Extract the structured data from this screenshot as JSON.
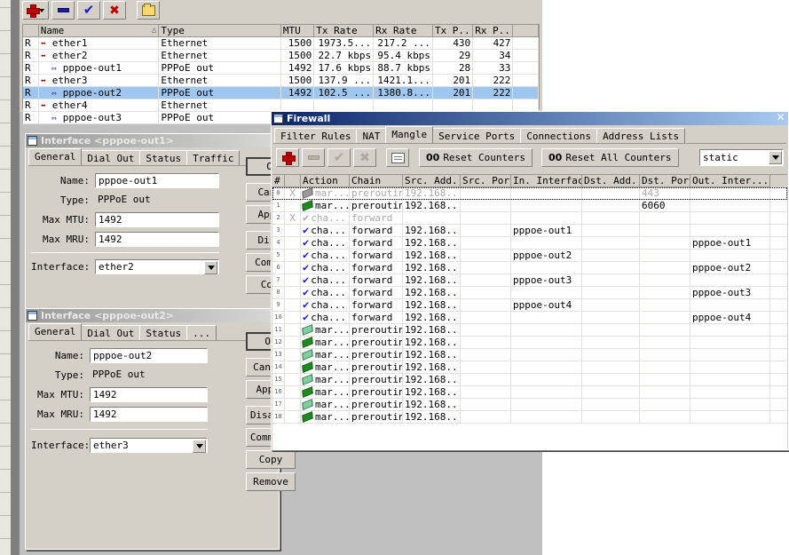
{
  "interface_window": {
    "toolbar": [
      {
        "name": "add-button",
        "icon": "plus-icon",
        "label": "+"
      },
      {
        "name": "remove-button",
        "icon": "minus-icon",
        "label": "-"
      },
      {
        "name": "enable-button",
        "icon": "check-icon",
        "label": "v"
      },
      {
        "name": "disable-button",
        "icon": "x-icon",
        "label": "x"
      },
      {
        "name": "comment-button",
        "icon": "folder-icon",
        "label": "folder"
      }
    ],
    "columns": [
      "",
      "Name",
      "Type",
      "MTU",
      "Tx Rate",
      "Rx Rate",
      "Tx P...",
      "Rx P...",
      ""
    ],
    "sort_column": "Name",
    "rows": [
      {
        "flag": "R",
        "name": "ether1",
        "type": "Ethernet",
        "mtu": "1500",
        "tx": "1973.5...",
        "rx": "217.2 ...",
        "txp": "430",
        "rxp": "427",
        "indent": 0,
        "icon": "ethernet-icon",
        "selected": false
      },
      {
        "flag": "R",
        "name": "ether2",
        "type": "Ethernet",
        "mtu": "1500",
        "tx": "22.7 kbps",
        "rx": "95.4 kbps",
        "txp": "29",
        "rxp": "34",
        "indent": 0,
        "icon": "ethernet-icon",
        "selected": false
      },
      {
        "flag": "R",
        "name": "pppoe-out1",
        "type": "PPPoE out",
        "mtu": "1492",
        "tx": "17.6 kbps",
        "rx": "88.7 kbps",
        "txp": "28",
        "rxp": "33",
        "indent": 1,
        "icon": "pppoe-icon",
        "selected": false
      },
      {
        "flag": "R",
        "name": "ether3",
        "type": "Ethernet",
        "mtu": "1500",
        "tx": "137.9 ...",
        "rx": "1421.1...",
        "txp": "201",
        "rxp": "222",
        "indent": 0,
        "icon": "ethernet-icon",
        "selected": false
      },
      {
        "flag": "R",
        "name": "pppoe-out2",
        "type": "PPPoE out",
        "mtu": "1492",
        "tx": "102.5 ...",
        "rx": "1380.8...",
        "txp": "201",
        "rxp": "222",
        "indent": 1,
        "icon": "pppoe-icon",
        "selected": true
      },
      {
        "flag": "R",
        "name": "ether4",
        "type": "Ethernet",
        "mtu": "",
        "tx": "",
        "rx": "",
        "txp": "",
        "rxp": "",
        "indent": 0,
        "icon": "ethernet-icon",
        "selected": false
      },
      {
        "flag": "R",
        "name": "pppoe-out3",
        "type": "PPPoE out",
        "mtu": "",
        "tx": "",
        "rx": "",
        "txp": "",
        "rxp": "",
        "indent": 1,
        "icon": "pppoe-icon",
        "selected": false
      }
    ]
  },
  "dialog1": {
    "title": "Interface <pppoe-out1>",
    "tabs": [
      "General",
      "Dial Out",
      "Status",
      "Traffic"
    ],
    "active_tab": "General",
    "fields": {
      "name_label": "Name:",
      "name_value": "pppoe-out1",
      "type_label": "Type:",
      "type_value": "PPPoE out",
      "mtu_label": "Max MTU:",
      "mtu_value": "1492",
      "mru_label": "Max MRU:",
      "mru_value": "1492",
      "interface_label": "Interface:",
      "interface_value": "ether2"
    },
    "buttons": [
      "OK",
      "Cance",
      "Apply",
      "Disab",
      "Commer",
      "Copy"
    ]
  },
  "dialog2": {
    "title": "Interface <pppoe-out2>",
    "tabs": [
      "General",
      "Dial Out",
      "Status",
      "..."
    ],
    "active_tab": "General",
    "fields": {
      "name_label": "Name:",
      "name_value": "pppoe-out2",
      "type_label": "Type:",
      "type_value": "PPPoE out",
      "mtu_label": "Max MTU:",
      "mtu_value": "1492",
      "mru_label": "Max MRU:",
      "mru_value": "1492",
      "interface_label": "Interface:",
      "interface_value": "ether3"
    },
    "buttons": [
      "OK",
      "Cancel",
      "Apply",
      "Disable",
      "Comment",
      "Copy",
      "Remove"
    ]
  },
  "firewall": {
    "title": "Firewall",
    "close_label": "✕",
    "tabs": [
      "Filter Rules",
      "NAT",
      "Mangle",
      "Service Ports",
      "Connections",
      "Address Lists"
    ],
    "active_tab": "Mangle",
    "toolbar": {
      "add_label": "+",
      "remove_label": "-",
      "enable_label": "✓",
      "disable_label": "✖",
      "comment_label": "note",
      "reset_counters": "Reset Counters",
      "reset_counters_prefix": "00",
      "reset_all_counters": "Reset All Counters",
      "reset_all_counters_prefix": "00",
      "filter_value": "static"
    },
    "columns": [
      "#",
      "",
      "Action",
      "Chain",
      "Src. Add...",
      "Src. Port",
      "In. Interface",
      "Dst. Add...",
      "Dst. Port",
      "Out. Inter..."
    ],
    "rows": [
      {
        "num": "0",
        "x": "X",
        "action": "mar...",
        "action_icon": "marker-gray-icon",
        "chain": "prerouting",
        "src": "192.168...",
        "srcport": "",
        "inif": "",
        "dst": "",
        "dstport": "443",
        "outif": "",
        "disabled": true,
        "focused": true
      },
      {
        "num": "1",
        "x": "",
        "action": "mar...",
        "action_icon": "marker-green-icon",
        "chain": "prerouting",
        "src": "192.168...",
        "srcport": "",
        "inif": "",
        "dst": "",
        "dstport": "6060",
        "outif": "",
        "disabled": false,
        "focused": false
      },
      {
        "num": "2",
        "x": "X",
        "action": "cha...",
        "action_icon": "check-gray-icon",
        "chain": "forward",
        "src": "",
        "srcport": "",
        "inif": "",
        "dst": "",
        "dstport": "",
        "outif": "",
        "disabled": true,
        "focused": false
      },
      {
        "num": "3",
        "x": "",
        "action": "cha...",
        "action_icon": "check-blue-icon",
        "chain": "forward",
        "src": "192.168...",
        "srcport": "",
        "inif": "pppoe-out1",
        "dst": "",
        "dstport": "",
        "outif": "",
        "disabled": false,
        "focused": false
      },
      {
        "num": "4",
        "x": "",
        "action": "cha...",
        "action_icon": "check-blue-icon",
        "chain": "forward",
        "src": "192.168...",
        "srcport": "",
        "inif": "",
        "dst": "",
        "dstport": "",
        "outif": "pppoe-out1",
        "disabled": false,
        "focused": false
      },
      {
        "num": "5",
        "x": "",
        "action": "cha...",
        "action_icon": "check-blue-icon",
        "chain": "forward",
        "src": "192.168...",
        "srcport": "",
        "inif": "pppoe-out2",
        "dst": "",
        "dstport": "",
        "outif": "",
        "disabled": false,
        "focused": false
      },
      {
        "num": "6",
        "x": "",
        "action": "cha...",
        "action_icon": "check-blue-icon",
        "chain": "forward",
        "src": "192.168...",
        "srcport": "",
        "inif": "",
        "dst": "",
        "dstport": "",
        "outif": "pppoe-out2",
        "disabled": false,
        "focused": false
      },
      {
        "num": "7",
        "x": "",
        "action": "cha...",
        "action_icon": "check-blue-icon",
        "chain": "forward",
        "src": "192.168...",
        "srcport": "",
        "inif": "pppoe-out3",
        "dst": "",
        "dstport": "",
        "outif": "",
        "disabled": false,
        "focused": false
      },
      {
        "num": "8",
        "x": "",
        "action": "cha...",
        "action_icon": "check-blue-icon",
        "chain": "forward",
        "src": "192.168...",
        "srcport": "",
        "inif": "",
        "dst": "",
        "dstport": "",
        "outif": "pppoe-out3",
        "disabled": false,
        "focused": false
      },
      {
        "num": "9",
        "x": "",
        "action": "cha...",
        "action_icon": "check-blue-icon",
        "chain": "forward",
        "src": "192.168...",
        "srcport": "",
        "inif": "pppoe-out4",
        "dst": "",
        "dstport": "",
        "outif": "",
        "disabled": false,
        "focused": false
      },
      {
        "num": "10",
        "x": "",
        "action": "cha...",
        "action_icon": "check-blue-icon",
        "chain": "forward",
        "src": "192.168...",
        "srcport": "",
        "inif": "",
        "dst": "",
        "dstport": "",
        "outif": "pppoe-out4",
        "disabled": false,
        "focused": false
      },
      {
        "num": "11",
        "x": "",
        "action": "mar...",
        "action_icon": "marker-lgreen-icon",
        "chain": "prerouting",
        "src": "192.168...",
        "srcport": "",
        "inif": "",
        "dst": "",
        "dstport": "",
        "outif": "",
        "disabled": false,
        "focused": false
      },
      {
        "num": "12",
        "x": "",
        "action": "mar...",
        "action_icon": "marker-green-icon",
        "chain": "prerouting",
        "src": "192.168...",
        "srcport": "",
        "inif": "",
        "dst": "",
        "dstport": "",
        "outif": "",
        "disabled": false,
        "focused": false
      },
      {
        "num": "13",
        "x": "",
        "action": "mar...",
        "action_icon": "marker-lgreen-icon",
        "chain": "prerouting",
        "src": "192.168...",
        "srcport": "",
        "inif": "",
        "dst": "",
        "dstport": "",
        "outif": "",
        "disabled": false,
        "focused": false
      },
      {
        "num": "14",
        "x": "",
        "action": "mar...",
        "action_icon": "marker-green-icon",
        "chain": "prerouting",
        "src": "192.168...",
        "srcport": "",
        "inif": "",
        "dst": "",
        "dstport": "",
        "outif": "",
        "disabled": false,
        "focused": false
      },
      {
        "num": "15",
        "x": "",
        "action": "mar...",
        "action_icon": "marker-lgreen-icon",
        "chain": "prerouting",
        "src": "192.168...",
        "srcport": "",
        "inif": "",
        "dst": "",
        "dstport": "",
        "outif": "",
        "disabled": false,
        "focused": false
      },
      {
        "num": "16",
        "x": "",
        "action": "mar...",
        "action_icon": "marker-green-icon",
        "chain": "prerouting",
        "src": "192.168...",
        "srcport": "",
        "inif": "",
        "dst": "",
        "dstport": "",
        "outif": "",
        "disabled": false,
        "focused": false
      },
      {
        "num": "17",
        "x": "",
        "action": "mar...",
        "action_icon": "marker-lgreen-icon",
        "chain": "prerouting",
        "src": "192.168...",
        "srcport": "",
        "inif": "",
        "dst": "",
        "dstport": "",
        "outif": "",
        "disabled": false,
        "focused": false
      },
      {
        "num": "18",
        "x": "",
        "action": "mar...",
        "action_icon": "marker-green-icon",
        "chain": "prerouting",
        "src": "192.168...",
        "srcport": "",
        "inif": "",
        "dst": "",
        "dstport": "",
        "outif": "",
        "disabled": false,
        "focused": false
      }
    ]
  },
  "colors": {
    "titlebar_active": "#0a246a",
    "selection": "#9fc6f0",
    "face": "#d4d0c8",
    "accent_red": "#c00000",
    "accent_blue": "#1a1ad0",
    "accent_green": "#1f8a1f"
  }
}
